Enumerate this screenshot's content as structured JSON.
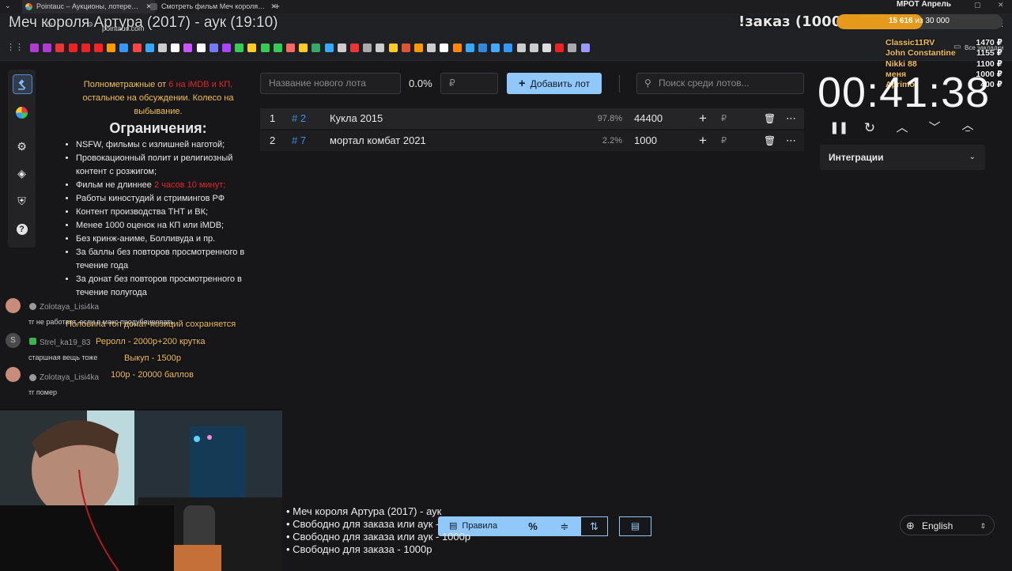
{
  "browser": {
    "tabs": [
      {
        "label": "Pointauc – Аукционы, лотере…",
        "active": true
      },
      {
        "label": "Смотреть фильм Меч короля…",
        "active": false
      }
    ],
    "new_tab": "+",
    "url": "pointauc.com",
    "all_bookmarks": "Все закладки"
  },
  "overlay": {
    "stream_title": "Меч короля Артура (2017) - аук (19:10)",
    "order_title": "!заказ (1000р)",
    "goal": {
      "label": "МРОТ Апрель",
      "current": "15 616",
      "of": "из 30 000",
      "fraction": 0.52
    },
    "top_donors": [
      {
        "name": "Classic11RV",
        "amount": "1470 ₽"
      },
      {
        "name": "John Constantine",
        "amount": "1155 ₽"
      },
      {
        "name": "Nikki 88",
        "amount": "1100 ₽"
      },
      {
        "name": "меня",
        "amount": "1000 ₽"
      },
      {
        "name": "Aprimo",
        "amount": "400 ₽"
      }
    ]
  },
  "rules": {
    "intro_a": "Полнометражные от ",
    "intro_b": "6 на iMDB и КП,",
    "intro_c": " остальное на обсуждении. Колесо на выбывание.",
    "heading": "Ограничения:",
    "items": [
      "NSFW, фильмы с излишней наготой;",
      "Провокационный полит и религиозный контент с розжигом;",
      "Фильм не длиннее ",
      "Работы киностудий и стримингов РФ",
      "Контент производства ТНТ и ВК;",
      "Менее 1000 оценок на КП или iMDB;",
      "Без кринж-аниме, Болливуда и пр.",
      "За баллы без повторов просмотренного в течение года",
      "За донат без повторов просмотренного в течение полугода"
    ],
    "duration_limit": "2 часов 10 минут;",
    "footer": "Половина топ донат-позиций сохраняется"
  },
  "donations": {
    "reroll": "Реролл - 2000р+200 крутка",
    "buyout": "Выкуп - 1500р",
    "points": "100р - 20000 баллов"
  },
  "chat": [
    {
      "user": "Zolotaya_Lisi4ka",
      "message": "тг не работает, если в макс продублировать",
      "avatar_color": "#c98c7a"
    },
    {
      "user": "Strel_ka19_83",
      "message": "старшная вещь тоже",
      "avatar_color": "#555"
    },
    {
      "user": "Zolotaya_Lisi4ka",
      "message": "тг помер",
      "avatar_color": "#c98c7a"
    }
  ],
  "controls": {
    "lot_name_placeholder": "Название нового лота",
    "percent": "0.0%",
    "amount_placeholder": "₽",
    "add_button": "Добавить лот",
    "search_placeholder": "Поиск среди лотов..."
  },
  "lots": [
    {
      "rank": "1",
      "id": "# 2",
      "name": "Кукла 2015",
      "percent": "97.8%",
      "amount": "44400",
      "currency": "₽"
    },
    {
      "rank": "2",
      "id": "# 7",
      "name": "мортал комбат 2021",
      "percent": "2.2%",
      "amount": "1000",
      "currency": "₽"
    }
  ],
  "timer": {
    "value": "00:41:38"
  },
  "integrations": {
    "label": "Интеграции"
  },
  "bottom_lines": [
    "• Меч короля Артура (2017) - аук",
    "• Свободно для заказа или аук - 1000р",
    "• Свободно для заказа или аук - 1000р",
    "• Свободно для заказа - 1000р"
  ],
  "toolbar": {
    "rules_label": "Правила",
    "percent_icon": "%"
  },
  "language": {
    "selected": "English"
  },
  "colors": {
    "accent": "#90c9f9",
    "id_blue": "#3d8fe0",
    "goal_bar": "#e69a1c",
    "donor": "#f2c04a"
  }
}
